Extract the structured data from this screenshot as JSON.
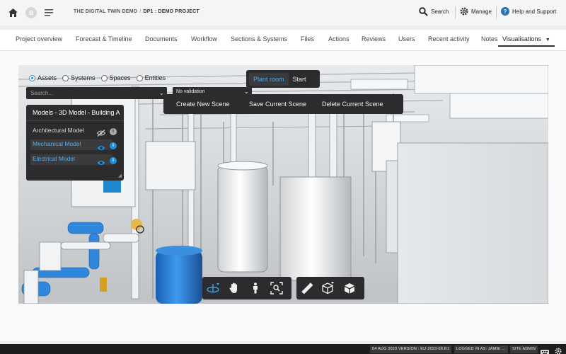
{
  "header": {
    "avatar_initial": "B",
    "company": "THE DIGITAL TWIN DEMO",
    "separator": "/",
    "project": "DP1 : DEMO PROJECT",
    "search_label": "Search",
    "manage_label": "Manage",
    "help_label": "Help and Support",
    "icons": [
      "home-icon",
      "menu-icon",
      "search-icon",
      "gear-icon",
      "help-icon"
    ]
  },
  "tabs": [
    {
      "label": "Project overview"
    },
    {
      "label": "Forecast & Timeline"
    },
    {
      "label": "Documents"
    },
    {
      "label": "Workflow"
    },
    {
      "label": "Sections & Systems"
    },
    {
      "label": "Files"
    },
    {
      "label": "Actions"
    },
    {
      "label": "Reviews"
    },
    {
      "label": "Users"
    },
    {
      "label": "Recent activity"
    },
    {
      "label": "Notes"
    },
    {
      "label": "Visualisations",
      "active": true
    }
  ],
  "filters": {
    "radios": [
      {
        "label": "Assets",
        "checked": true
      },
      {
        "label": "Systems",
        "checked": false
      },
      {
        "label": "Spaces",
        "checked": false
      },
      {
        "label": "Entities",
        "checked": false
      }
    ],
    "search_placeholder": "Search...",
    "validation_value": "No validation"
  },
  "scene": {
    "options": [
      "Plant room",
      "Start"
    ],
    "active_option": "Plant room",
    "menu": [
      "Create New Scene",
      "Save Current Scene",
      "Delete Current Scene"
    ]
  },
  "models_panel": {
    "title": "Models - 3D Model - Building A",
    "items": [
      {
        "label": "Architectural Model",
        "visible": false
      },
      {
        "label": "Mechanical Model",
        "visible": true
      },
      {
        "label": "Electrical Model",
        "visible": true
      }
    ]
  },
  "toolbar": {
    "groups": [
      [
        "orbit-icon",
        "pan-hand-icon",
        "walk-person-icon",
        "fit-view-icon"
      ],
      [
        "measure-ruler-icon",
        "section-box-icon",
        "model-cube-icon"
      ]
    ]
  },
  "footer": {
    "version": "04 AUG 2023 VERSION : EU-2023-08.R1",
    "logged_in": "LOGGED IN AS: JAMIE ...",
    "role": "SITE ADMIN"
  },
  "colors": {
    "accent": "#2b8fd8",
    "panel_dark": "#2c2c2e",
    "highlight_blue": "#52aef0"
  }
}
